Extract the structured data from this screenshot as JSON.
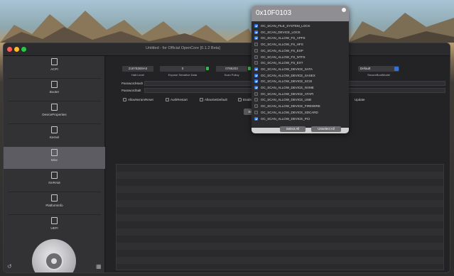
{
  "window": {
    "title": "Untitled - for Official OpenCore [0.1.2 Beta]"
  },
  "sidebar": {
    "items": [
      {
        "label": "ACPI",
        "icon": "acpi-icon"
      },
      {
        "label": "Booter",
        "icon": "booter-icon"
      },
      {
        "label": "DeviceProperties",
        "icon": "device-properties-icon"
      },
      {
        "label": "Kernel",
        "icon": "kernel-icon"
      },
      {
        "label": "Misc",
        "icon": "misc-icon"
      },
      {
        "label": "NVRAM",
        "icon": "nvram-icon"
      },
      {
        "label": "PlatformInfo",
        "icon": "platform-info-icon"
      },
      {
        "label": "UEFI",
        "icon": "uefi-icon"
      }
    ],
    "active_index": 4
  },
  "main": {
    "fields": [
      {
        "value": "2187B3B9A0",
        "caption": "Halt Level"
      },
      {
        "value": "0",
        "caption": "Expose Sensitive Data"
      },
      {
        "value": "0786203",
        "caption": "Scan Policy"
      }
    ],
    "select": {
      "value": "Default",
      "caption": "SecureBootModel"
    },
    "password_hash_label": "PasswordHash",
    "password_salt_label": "PasswordSalt",
    "checkboxes": [
      "AllowNvramReset",
      "AuthRestart",
      "AllowSetDefault",
      "Enable"
    ],
    "extra_label": "Update",
    "browse_button": "Bro"
  },
  "popover": {
    "title": "0x10F0103",
    "items": [
      {
        "label": "OC_SCAN_FILE_SYSTEM_LOCK",
        "checked": true
      },
      {
        "label": "OC_SCAN_DEVICE_LOCK",
        "checked": true
      },
      {
        "label": "OC_SCAN_ALLOW_FS_APFS",
        "checked": true
      },
      {
        "label": "OC_SCAN_ALLOW_FS_HFS",
        "checked": false
      },
      {
        "label": "OC_SCAN_ALLOW_FS_ESP",
        "checked": false
      },
      {
        "label": "OC_SCAN_ALLOW_FS_NTFS",
        "checked": false
      },
      {
        "label": "OC_SCAN_ALLOW_FS_EXT",
        "checked": false
      },
      {
        "label": "OC_SCAN_ALLOW_DEVICE_SATA",
        "checked": true
      },
      {
        "label": "OC_SCAN_ALLOW_DEVICE_SASEX",
        "checked": true
      },
      {
        "label": "OC_SCAN_ALLOW_DEVICE_SCSI",
        "checked": true
      },
      {
        "label": "OC_SCAN_ALLOW_DEVICE_NVME",
        "checked": true
      },
      {
        "label": "OC_SCAN_ALLOW_DEVICE_ATAPI",
        "checked": false
      },
      {
        "label": "OC_SCAN_ALLOW_DEVICE_USB",
        "checked": false
      },
      {
        "label": "OC_SCAN_ALLOW_DEVICE_FIREWIRE",
        "checked": false
      },
      {
        "label": "OC_SCAN_ALLOW_DEVICE_SDCARD",
        "checked": false
      },
      {
        "label": "OC_SCAN_ALLOW_DEVICE_PCI",
        "checked": true
      }
    ],
    "select_all": "Select All",
    "unselect_all": "Unselect All"
  },
  "colors": {
    "accent": "#2f72e0",
    "traffic_close": "#ff5f57",
    "traffic_min": "#febc2e",
    "traffic_max": "#28c840"
  }
}
